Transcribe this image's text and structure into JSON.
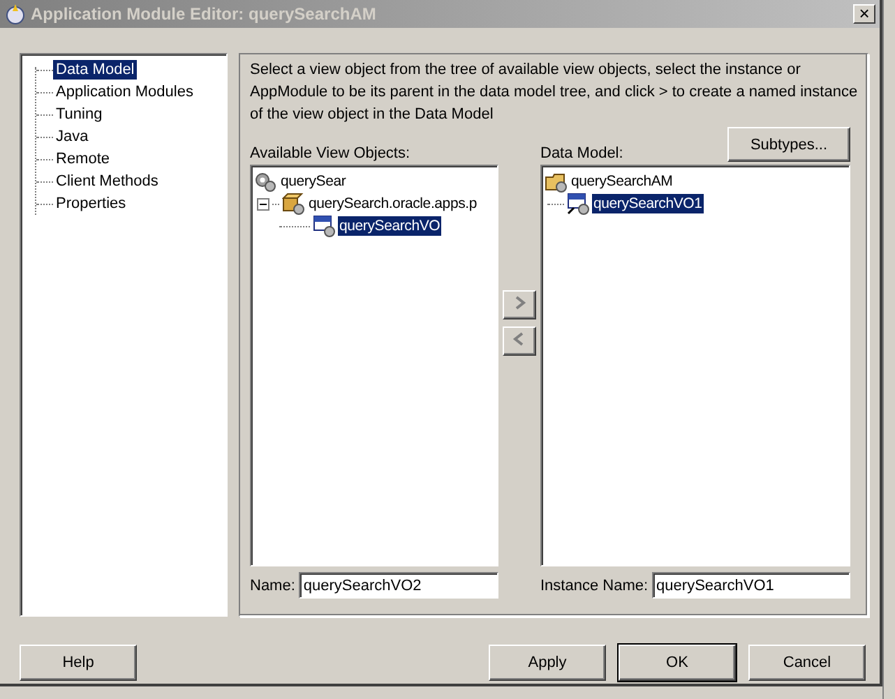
{
  "window": {
    "title": "Application Module Editor: querySearchAM",
    "close": "×"
  },
  "nav": {
    "items": [
      {
        "label": "Data Model",
        "selected": true
      },
      {
        "label": "Application Modules",
        "selected": false
      },
      {
        "label": "Tuning",
        "selected": false
      },
      {
        "label": "Java",
        "selected": false
      },
      {
        "label": "Remote",
        "selected": false
      },
      {
        "label": "Client Methods",
        "selected": false
      },
      {
        "label": "Properties",
        "selected": false
      }
    ]
  },
  "description": "Select a view object from the tree of available view objects, select the instance or AppModule to be its parent in the data model tree, and click > to create a named instance of the view object in the Data Model",
  "available": {
    "label": "Available View Objects:",
    "tree": [
      {
        "label": "querySear",
        "kind": "project",
        "selected": false,
        "children": [
          {
            "label": "querySearch.oracle.apps.p",
            "kind": "package",
            "selected": false,
            "expanded": true,
            "children": [
              {
                "label": "querySearchVO",
                "kind": "view",
                "selected": true
              }
            ]
          }
        ]
      }
    ],
    "name_label": "Name:",
    "name_value": "querySearchVO2"
  },
  "data_model": {
    "label": "Data Model:",
    "subtypes_button": "Subtypes...",
    "tree": [
      {
        "label": "querySearchAM",
        "kind": "module",
        "selected": false,
        "children": [
          {
            "label": "querySearchVO1",
            "kind": "instance",
            "selected": true
          }
        ]
      }
    ],
    "name_label": "Instance Name:",
    "name_value": "querySearchVO1"
  },
  "buttons": {
    "help": "Help",
    "apply": "Apply",
    "ok": "OK",
    "cancel": "Cancel"
  }
}
